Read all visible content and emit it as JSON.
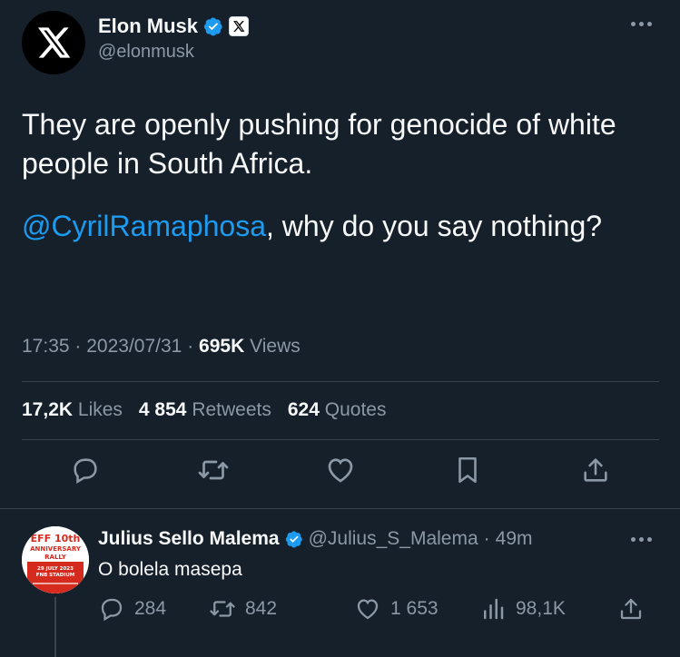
{
  "author": {
    "name": "Elon Musk",
    "handle": "@elonmusk"
  },
  "tweet": {
    "line1": "They are openly pushing for genocide of white people in South Africa.",
    "mention": "@CyrilRamaphosa",
    "line2_rest": ", why do you say nothing?"
  },
  "meta": {
    "time": "17:35",
    "sep1": "·",
    "date": "2023/07/31",
    "sep2": "·",
    "views_count": "695K",
    "views_label": "Views"
  },
  "stats": {
    "likes_count": "17,2K",
    "likes_label": "Likes",
    "retweets_count": "4 854",
    "retweets_label": "Retweets",
    "quotes_count": "624",
    "quotes_label": "Quotes"
  },
  "reply": {
    "name": "Julius Sello Malema",
    "handle": "@Julius_S_Malema",
    "sep": "·",
    "age": "49m",
    "text": "O bolela masepa",
    "avatar_text": {
      "line1": "EFF 10th",
      "line2": "ANNIVERSARY",
      "line3": "RALLY",
      "line4": "29 JULY 2023",
      "line5": "FNB STADIUM"
    },
    "replies": "284",
    "retweets": "842",
    "likes": "1 653",
    "views": "98,1K"
  },
  "colors": {
    "background": "#15202b",
    "text": "#f7f9f9",
    "muted": "#8b98a5",
    "accent": "#1d9bf0",
    "divider": "#38444d",
    "eff_red": "#d52b1e"
  }
}
